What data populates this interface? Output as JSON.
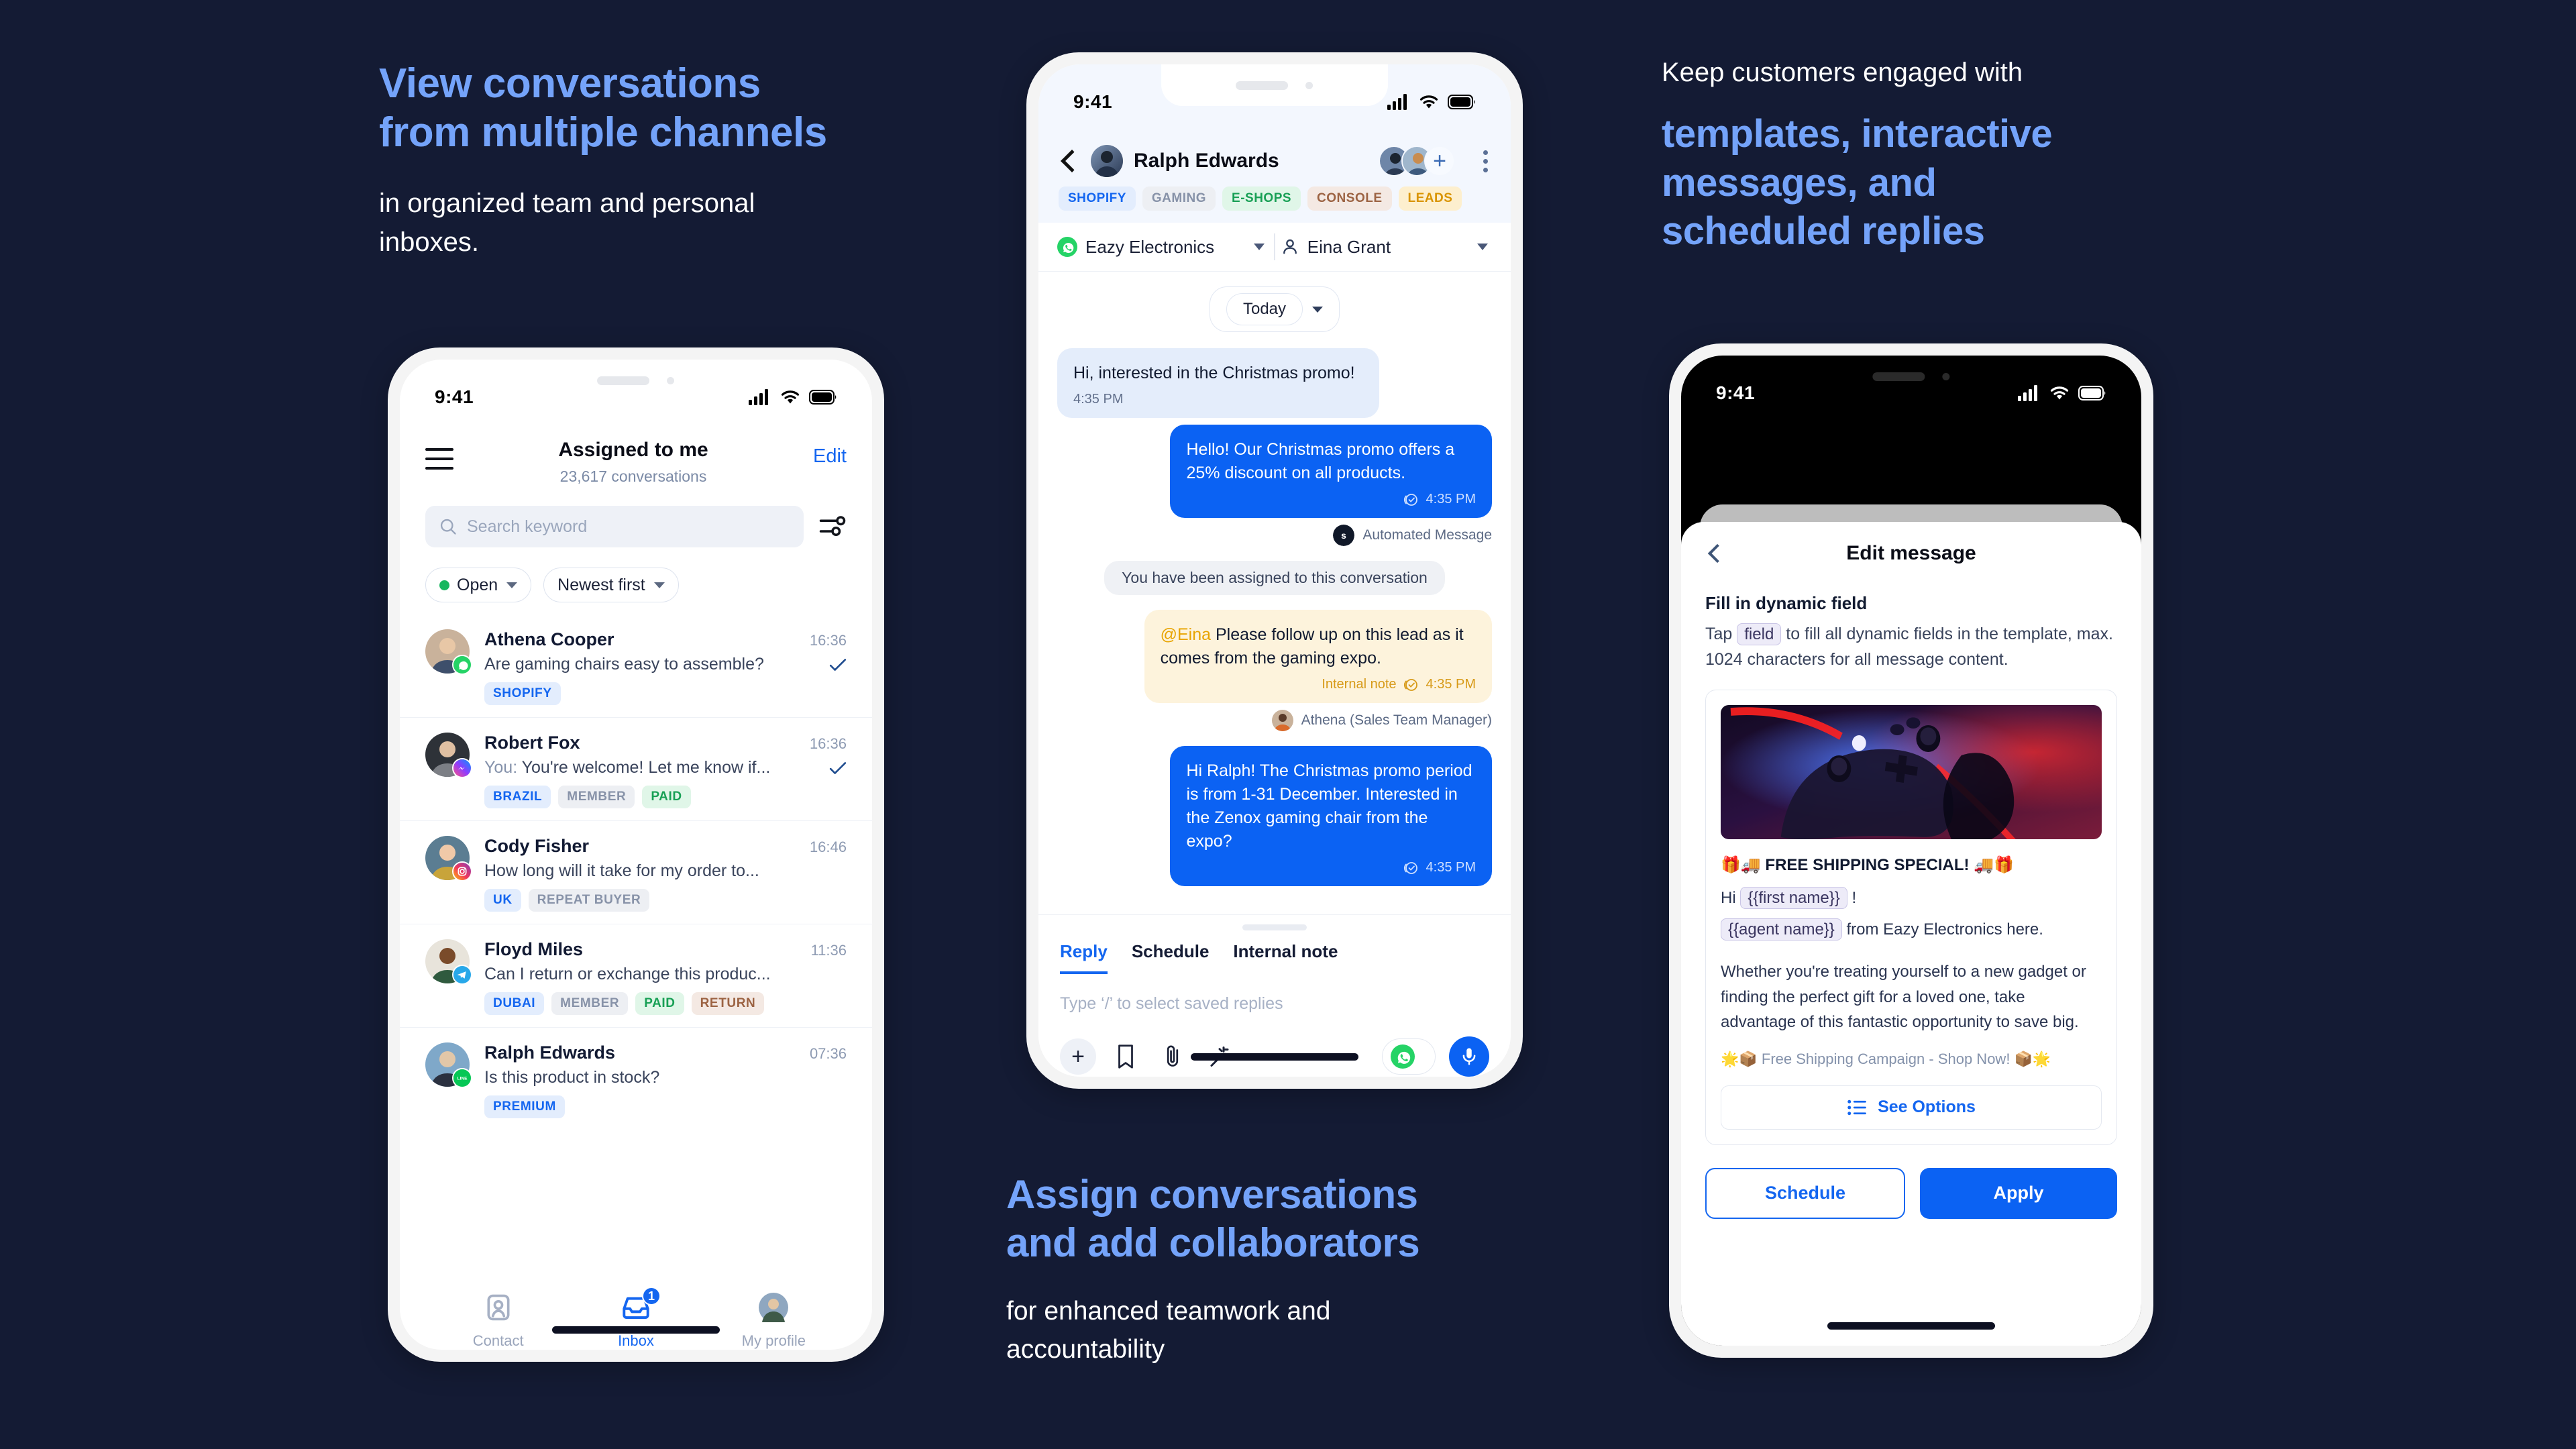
{
  "background_color": "#141B34",
  "accent_color": "#1466F0",
  "copy": {
    "left": {
      "headline": "View conversations\nfrom multiple channels",
      "sub": "in organized team and personal\ninboxes."
    },
    "mid": {
      "headline": "Assign conversations\nand add collaborators",
      "sub": "for enhanced teamwork and\naccountability"
    },
    "right": {
      "sub": "Keep customers engaged with",
      "headline": "templates, interactive\nmessages, and\nscheduled replies"
    }
  },
  "left_phone": {
    "status": {
      "time": "9:41"
    },
    "header": {
      "menu_icon": "hamburger-icon",
      "title": "Assigned to me",
      "subtitle": "23,617 conversations",
      "edit_label": "Edit"
    },
    "search": {
      "placeholder": "Search keyword",
      "icon": "search-icon",
      "filter_icon": "filter-sliders-icon"
    },
    "filters": [
      {
        "label": "Open",
        "has_dot": true,
        "dot_color": "#18B75E"
      },
      {
        "label": "Newest first",
        "has_dot": false
      }
    ],
    "conversations": [
      {
        "name": "Athena Cooper",
        "time": "16:36",
        "preview": "Are gaming chairs easy to assemble?",
        "prefix": "",
        "channel": "whatsapp",
        "read": true,
        "tags": [
          {
            "label": "SHOPIFY",
            "style": "t-blue"
          }
        ]
      },
      {
        "name": "Robert Fox",
        "time": "16:36",
        "preview": "You're welcome! Let me know if...",
        "prefix": "You: ",
        "channel": "messenger",
        "read": true,
        "tags": [
          {
            "label": "BRAZIL",
            "style": "t-blue"
          },
          {
            "label": "MEMBER",
            "style": "t-gray"
          },
          {
            "label": "PAID",
            "style": "t-green"
          }
        ]
      },
      {
        "name": "Cody Fisher",
        "time": "16:46",
        "preview": "How long will it take for my order to...",
        "prefix": "",
        "channel": "instagram",
        "read": false,
        "tags": [
          {
            "label": "UK",
            "style": "t-blue"
          },
          {
            "label": "REPEAT BUYER",
            "style": "t-gray"
          }
        ]
      },
      {
        "name": "Floyd Miles",
        "time": "11:36",
        "preview": "Can I return or exchange this produc...",
        "prefix": "",
        "channel": "telegram",
        "read": false,
        "tags": [
          {
            "label": "DUBAI",
            "style": "t-blue"
          },
          {
            "label": "MEMBER",
            "style": "t-gray"
          },
          {
            "label": "PAID",
            "style": "t-green"
          },
          {
            "label": "RETURN",
            "style": "t-brown"
          }
        ]
      },
      {
        "name": "Ralph Edwards",
        "time": "07:36",
        "preview": "Is this product in stock?",
        "prefix": "",
        "channel": "line",
        "read": false,
        "tags": [
          {
            "label": "PREMIUM",
            "style": "t-blue"
          }
        ]
      }
    ],
    "tabs": [
      {
        "label": "Contact",
        "icon": "contact-card-icon",
        "active": false,
        "badge": ""
      },
      {
        "label": "Inbox",
        "icon": "inbox-tray-icon",
        "active": true,
        "badge": "1"
      },
      {
        "label": "My profile",
        "icon": "avatar-icon",
        "active": false,
        "badge": ""
      }
    ]
  },
  "center_phone": {
    "status": {
      "time": "9:41"
    },
    "header": {
      "back_icon": "back-chevron-icon",
      "contact_name": "Ralph Edwards",
      "add_collaborator_label": "+",
      "more_icon": "kebab-menu-icon"
    },
    "tags": [
      {
        "label": "SHOPIFY",
        "style": "t-blue"
      },
      {
        "label": "GAMING",
        "style": "t-gray"
      },
      {
        "label": "E-SHOPS",
        "style": "t-green"
      },
      {
        "label": "CONSOLE",
        "style": "t-brown"
      },
      {
        "label": "LEADS",
        "style": "t-yellow"
      }
    ],
    "selects": [
      {
        "label": "Eazy Electronics",
        "icon": "whatsapp-icon"
      },
      {
        "label": "Eina Grant",
        "icon": "person-icon"
      }
    ],
    "day_divider": "Today",
    "messages": [
      {
        "type": "in",
        "text": "Hi, interested in the Christmas promo!",
        "time": "4:35 PM"
      },
      {
        "type": "out",
        "text": "Hello! Our Christmas promo offers a 25% discount on all products.",
        "time": "4:35 PM",
        "sender": "Automated Message",
        "sender_avatar": "sleekflow-logo"
      },
      {
        "type": "system",
        "text": "You have been assigned to this conversation"
      },
      {
        "type": "note",
        "mention": "@Eina",
        "text": " Please follow up on this lead as it comes from the gaming expo.",
        "note_label": "Internal note",
        "time": "4:35 PM",
        "sender": "Athena (Sales Team Manager)"
      },
      {
        "type": "out",
        "text": "Hi Ralph! The Christmas promo period is from 1-31 December. Interested in the Zenox gaming chair from the expo?",
        "time": "4:35 PM"
      }
    ],
    "composer": {
      "tabs": [
        {
          "label": "Reply",
          "active": true
        },
        {
          "label": "Schedule",
          "active": false
        },
        {
          "label": "Internal note",
          "active": false
        }
      ],
      "placeholder": "Type ‘/’ to select saved replies",
      "tools": [
        "plus-icon",
        "bookmark-icon",
        "paperclip-icon",
        "magic-wand-icon"
      ],
      "channel_icon": "whatsapp-icon",
      "send_icon": "microphone-icon"
    }
  },
  "right_phone": {
    "status": {
      "time": "9:41"
    },
    "nav": {
      "back_icon": "back-chevron-icon",
      "title": "Edit message"
    },
    "section_heading": "Fill in dynamic field",
    "instruction_before": "Tap",
    "instruction_chip": "field",
    "instruction_after": "to fill all dynamic fields in the template, max. 1024 characters for all message content.",
    "template": {
      "image_alt": "game-controller-photo",
      "title": "🎁🚚 FREE SHIPPING SPECIAL! 🚚🎁",
      "greeting_before": "Hi",
      "greeting_chip": "{{first name}}",
      "greeting_after": "!",
      "agent_chip": "{{agent name}}",
      "agent_after": "from Eazy Electronics here.",
      "paragraph": "Whether you're treating yourself to a new gadget or finding the perfect gift for a loved one, take advantage of this fantastic opportunity to save big.",
      "footer": "🌟📦 Free Shipping Campaign - Shop Now! 📦🌟",
      "option_button": "See Options",
      "option_icon": "list-icon"
    },
    "actions": [
      {
        "label": "Schedule",
        "style": "outline"
      },
      {
        "label": "Apply",
        "style": "solid"
      }
    ]
  }
}
